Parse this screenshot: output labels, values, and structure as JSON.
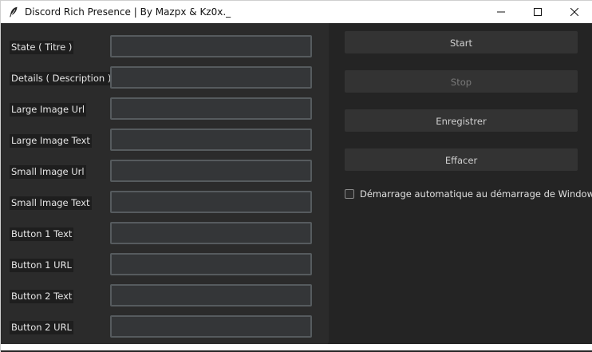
{
  "window": {
    "title": "Discord Rich Presence | By Mazpx & Kz0x._",
    "icon": "feather-icon"
  },
  "titlebar_controls": {
    "minimize_icon": "minimize-icon",
    "maximize_icon": "maximize-icon",
    "close_icon": "close-icon"
  },
  "form": {
    "fields": [
      {
        "label": "State ( Titre )",
        "value": ""
      },
      {
        "label": "Details ( Description )",
        "value": ""
      },
      {
        "label": "Large Image Url",
        "value": ""
      },
      {
        "label": "Large Image Text",
        "value": ""
      },
      {
        "label": "Small Image Url",
        "value": ""
      },
      {
        "label": "Small Image Text",
        "value": ""
      },
      {
        "label": "Button 1 Text",
        "value": ""
      },
      {
        "label": "Button 1 URL",
        "value": ""
      },
      {
        "label": "Button 2 Text",
        "value": ""
      },
      {
        "label": "Button 2 URL",
        "value": ""
      }
    ]
  },
  "actions": {
    "start_label": "Start",
    "stop_label": "Stop",
    "save_label": "Enregistrer",
    "clear_label": "Effacer",
    "stop_disabled": true
  },
  "autostart": {
    "label": "Démarrage automatique au démarrage de Windows",
    "checked": false
  },
  "colors": {
    "window_bg": "#242424",
    "panel_bg": "#2b2b2b",
    "input_bg": "#343638",
    "input_border": "#565b5e",
    "button_bg": "#333333",
    "text": "#e6e6e6"
  }
}
